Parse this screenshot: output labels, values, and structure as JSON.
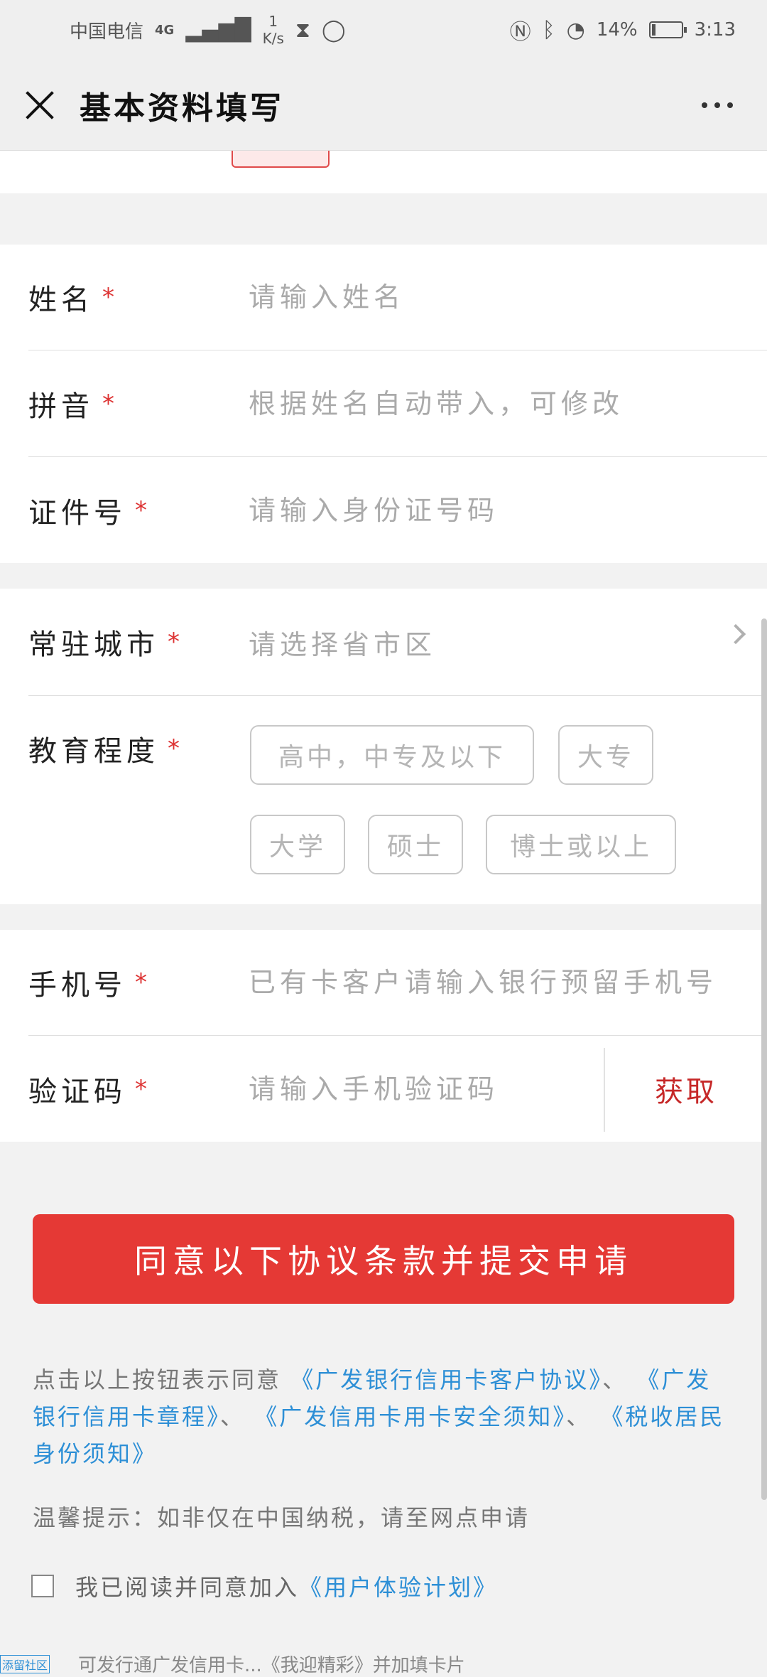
{
  "status_bar": {
    "carrier": "中国电信",
    "network": "4G",
    "speed_value": "1",
    "speed_unit": "K/s",
    "battery": "14%",
    "time": "3:13",
    "battery_level": 0.14
  },
  "header": {
    "title": "基本资料填写"
  },
  "form": {
    "name": {
      "label": "姓名",
      "required": "*",
      "placeholder": "请输入姓名"
    },
    "pinyin": {
      "label": "拼音",
      "required": "*",
      "placeholder": "根据姓名自动带入，可修改"
    },
    "id_number": {
      "label": "证件号",
      "required": "*",
      "placeholder": "请输入身份证号码"
    },
    "city": {
      "label": "常驻城市",
      "required": "*",
      "placeholder": "请选择省市区"
    },
    "education": {
      "label": "教育程度",
      "required": "*",
      "options": [
        "高中，中专及以下",
        "大专",
        "大学",
        "硕士",
        "博士或以上"
      ]
    },
    "phone": {
      "label": "手机号",
      "required": "*",
      "placeholder": "已有卡客户请输入银行预留手机号"
    },
    "code": {
      "label": "验证码",
      "required": "*",
      "placeholder": "请输入手机验证码",
      "get_label": "获取"
    }
  },
  "submit": {
    "label": "同意以下协议条款并提交申请"
  },
  "agreement": {
    "prefix": "点击以上按钮表示同意 ",
    "link1": "《广发银行信用卡客户协议》",
    "sep1": "、 ",
    "link2": "《广发银行信用卡章程》",
    "sep2": "、 ",
    "link3": "《广发信用卡用卡安全须知》",
    "sep3": "、 ",
    "link4": "《税收居民身份须知》"
  },
  "tip": "温馨提示：如非仅在中国纳税，请至网点申请",
  "consent": {
    "text": "我已阅读并同意加入 ",
    "link": "《用户体验计划》"
  },
  "bottom": {
    "badge": "添留社区",
    "text": "可发行通广发信用卡...《我迎精彩》并加填卡片"
  }
}
